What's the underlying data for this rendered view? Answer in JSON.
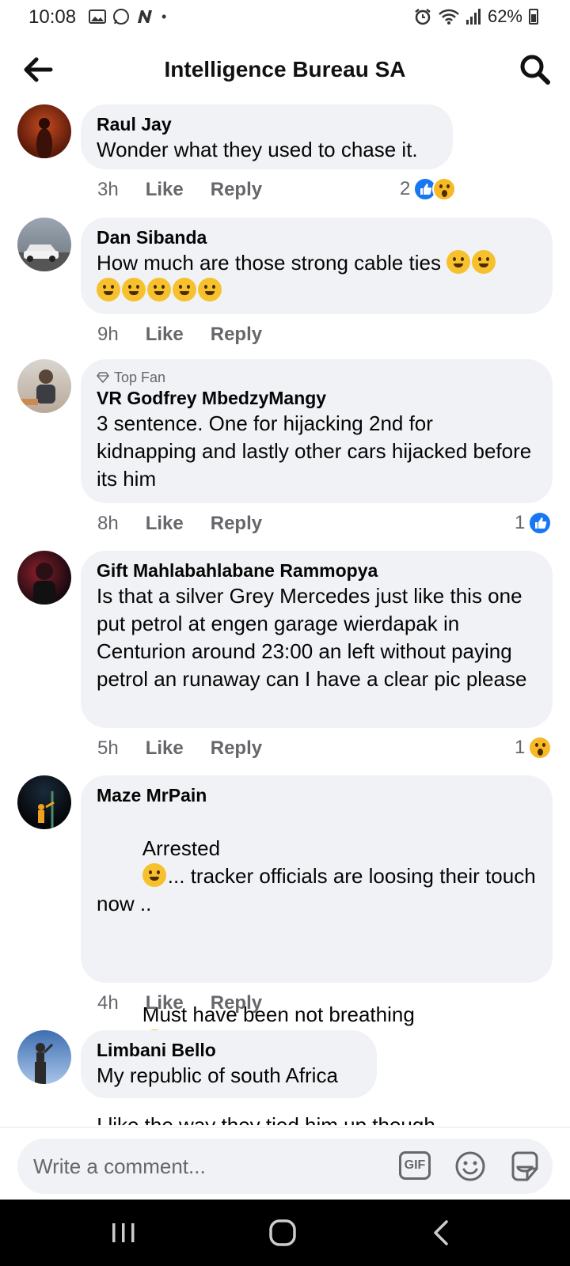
{
  "status": {
    "time": "10:08",
    "battery": "62%"
  },
  "header": {
    "title": "Intelligence Bureau SA"
  },
  "comments": [
    {
      "name": "Raul Jay",
      "text": "Wonder what they used to chase it.",
      "time": "3h",
      "like": "Like",
      "reply": "Reply",
      "reaction_count": "2"
    },
    {
      "name": "Dan Sibanda",
      "text": "How much are those strong cable ties",
      "time": "9h",
      "like": "Like",
      "reply": "Reply"
    },
    {
      "badge": "Top Fan",
      "name": "VR Godfrey MbedzyMangy",
      "text": "3 sentence. One for hijacking 2nd for kidnapping and lastly other cars hijacked before its him",
      "time": "8h",
      "like": "Like",
      "reply": "Reply",
      "reaction_count": "1"
    },
    {
      "name": "Gift Mahlabahlabane Rammopya",
      "text": "Is that a silver Grey Mercedes just like this one put petrol at engen garage wierdapak in Centurion around 23:00 an left without paying petrol an runaway can I have a clear pic please",
      "time": "5h",
      "like": "Like",
      "reply": "Reply",
      "reaction_count": "1"
    },
    {
      "name": "Maze MrPain",
      "text_a": "Arrested",
      "text_b": "... tracker officials are loosing their touch now ..",
      "text_c": "Must have been not breathing",
      "text_d": "I like the way they tied him up though",
      "time": "4h",
      "like": "Like",
      "reply": "Reply"
    },
    {
      "name": "Limbani Bello",
      "text": "My republic of south Africa"
    }
  ],
  "composer": {
    "placeholder": "Write a comment...",
    "gif": "GIF"
  },
  "colors": {
    "like_blue": "#1877f2",
    "bubble": "#f0f2f5",
    "meta_gray": "#65676b"
  }
}
